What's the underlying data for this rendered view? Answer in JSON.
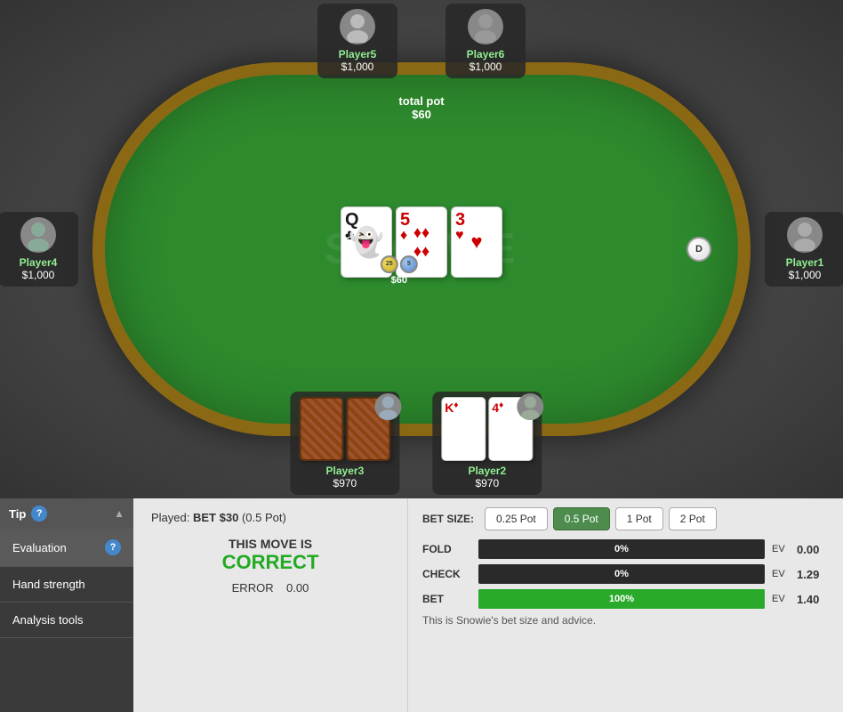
{
  "table": {
    "watermark": "SNOWIE",
    "pot_label": "total pot",
    "pot_amount": "$60"
  },
  "players": {
    "player5": {
      "name": "Player5",
      "stack": "$1,000"
    },
    "player6": {
      "name": "Player6",
      "stack": "$1,000"
    },
    "player4": {
      "name": "Player4",
      "stack": "$1,000"
    },
    "player1": {
      "name": "Player1",
      "stack": "$1,000"
    },
    "player3": {
      "name": "Player3",
      "stack": "$970"
    },
    "player2": {
      "name": "Player2",
      "stack": "$970"
    }
  },
  "community_cards": [
    {
      "rank": "Q",
      "suit": "♣",
      "color": "black"
    },
    {
      "rank": "5",
      "suit": "♦",
      "color": "red"
    },
    {
      "rank": "3",
      "suit": "♥",
      "color": "red"
    }
  ],
  "chips": {
    "amount": "$60"
  },
  "dealer_button": "D",
  "sidebar": {
    "tip_label": "Tip",
    "evaluation_label": "Evaluation",
    "hand_strength_label": "Hand strength",
    "analysis_tools_label": "Analysis tools"
  },
  "evaluation": {
    "played_label": "Played:",
    "played_action": "BET $30",
    "played_detail": "(0.5 Pot)",
    "this_move_label": "THIS MOVE IS",
    "correct_label": "CORRECT",
    "error_label": "ERROR",
    "error_value": "0.00"
  },
  "bet_sizes": {
    "label": "BET SIZE:",
    "options": [
      "0.25 Pot",
      "0.5 Pot",
      "1 Pot",
      "2 Pot"
    ],
    "active": "0.5 Pot"
  },
  "actions": [
    {
      "name": "FOLD",
      "pct": "0%",
      "fill_width": 0,
      "fill_color": "#555",
      "ev_label": "EV",
      "ev_value": "0.00"
    },
    {
      "name": "CHECK",
      "pct": "0%",
      "fill_width": 0,
      "fill_color": "#555",
      "ev_label": "EV",
      "ev_value": "1.29"
    },
    {
      "name": "BET",
      "pct": "100%",
      "fill_width": 100,
      "fill_color": "#2aaa2a",
      "ev_label": "EV",
      "ev_value": "1.40"
    }
  ],
  "snowie_advice": "This is Snowie's bet size and advice."
}
